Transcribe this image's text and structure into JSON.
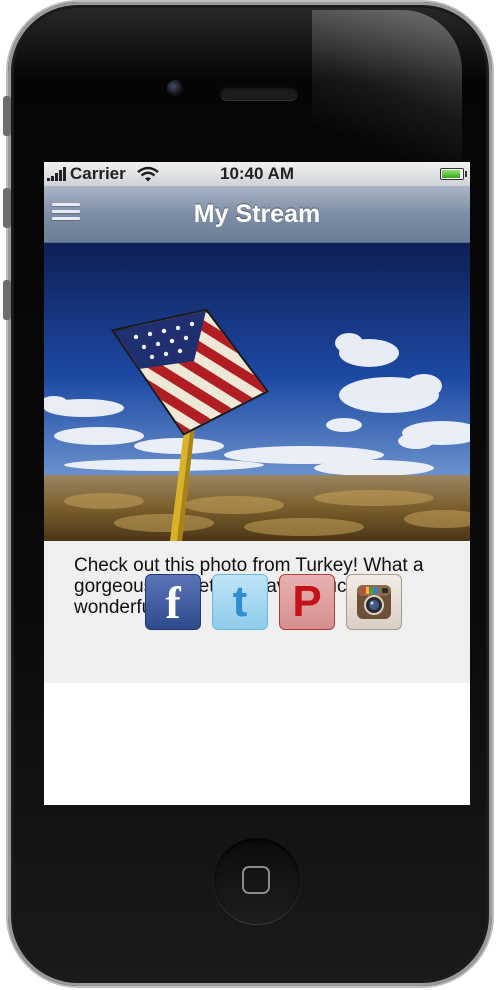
{
  "status_bar": {
    "carrier": "Carrier",
    "time": "10:40 AM",
    "battery_level": 1.0
  },
  "nav_bar": {
    "title": "My Stream",
    "menu_icon": "menu-icon"
  },
  "post": {
    "text": "Check out this photo from Turkey!  What a gorgeous sunset! I’m having such a wonderful time"
  },
  "share_buttons": [
    {
      "label": "f",
      "icon": "facebook-icon"
    },
    {
      "label": "t",
      "icon": "twitter-icon"
    },
    {
      "label": "P",
      "icon": "pinterest-icon"
    },
    {
      "label": "",
      "icon": "instagram-icon"
    }
  ],
  "colors": {
    "nav_bar": "#7d8ea6",
    "post_background": "#efefef",
    "facebook": "#3b5998",
    "twitter": "#8fcceb",
    "pinterest": "#c3121a"
  }
}
